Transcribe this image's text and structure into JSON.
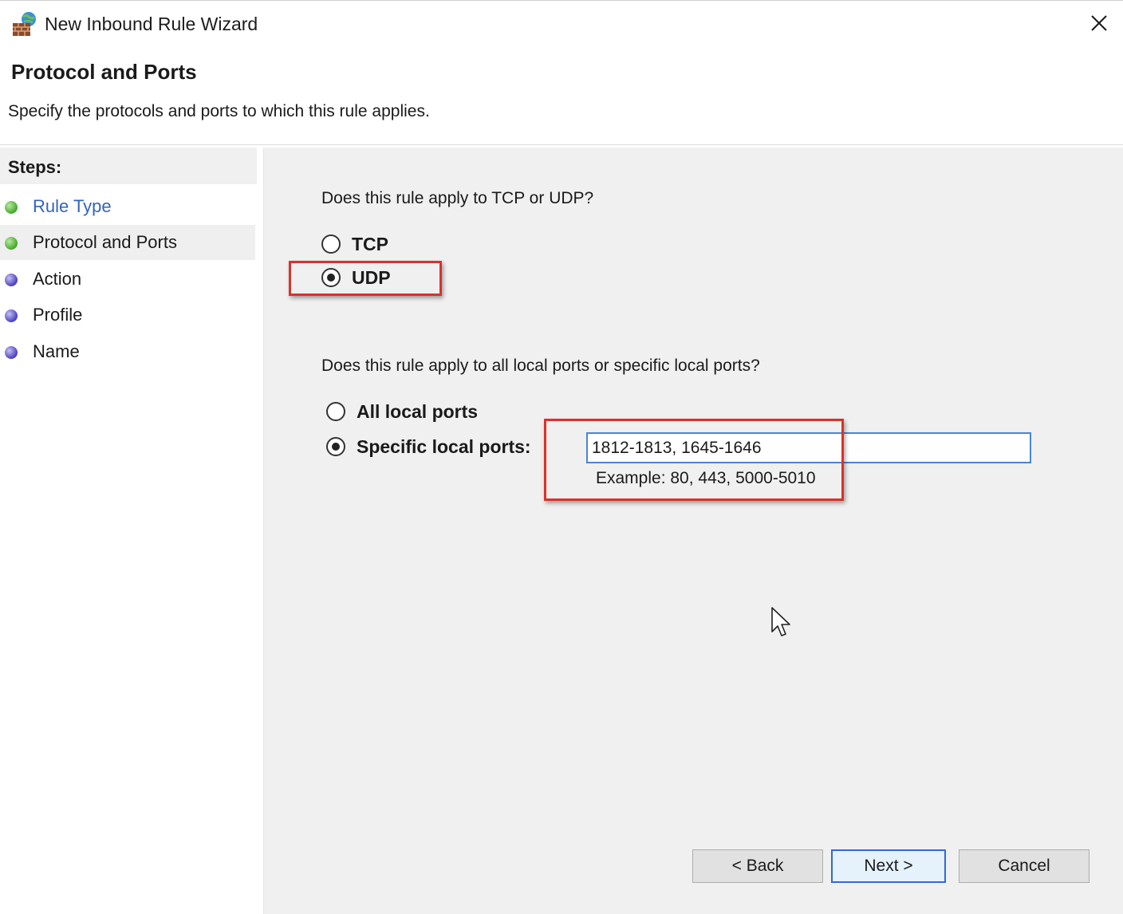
{
  "window": {
    "title": "New Inbound Rule Wizard",
    "icon": "firewall-globe-icon",
    "close_icon": "close-icon"
  },
  "header": {
    "title": "Protocol and Ports",
    "subtitle": "Specify the protocols and ports to which this rule applies."
  },
  "steps": {
    "header": "Steps:",
    "items": [
      {
        "label": "Rule Type",
        "status": "completed",
        "dot_color": "#45a72c",
        "is_link": true
      },
      {
        "label": "Protocol and Ports",
        "status": "current",
        "dot_color": "#45a72c",
        "is_link": false
      },
      {
        "label": "Action",
        "status": "pending",
        "dot_color": "#4b3fbf",
        "is_link": false
      },
      {
        "label": "Profile",
        "status": "pending",
        "dot_color": "#4b3fbf",
        "is_link": false
      },
      {
        "label": "Name",
        "status": "pending",
        "dot_color": "#4b3fbf",
        "is_link": false
      }
    ]
  },
  "protocol": {
    "question": "Does this rule apply to TCP or UDP?",
    "options": [
      {
        "label": "TCP",
        "checked": false
      },
      {
        "label": "UDP",
        "checked": true
      }
    ]
  },
  "ports": {
    "question": "Does this rule apply to all local ports or specific local ports?",
    "options": [
      {
        "label": "All local ports",
        "checked": false
      },
      {
        "label": "Specific local ports:",
        "checked": true
      }
    ],
    "value": "1812-1813, 1645-1646",
    "example": "Example: 80, 443, 5000-5010"
  },
  "buttons": {
    "back": "< Back",
    "next": "Next >",
    "cancel": "Cancel"
  },
  "colors": {
    "highlight": "#d9322a",
    "link": "#3264b8",
    "focus_border": "#2f6bd3"
  }
}
